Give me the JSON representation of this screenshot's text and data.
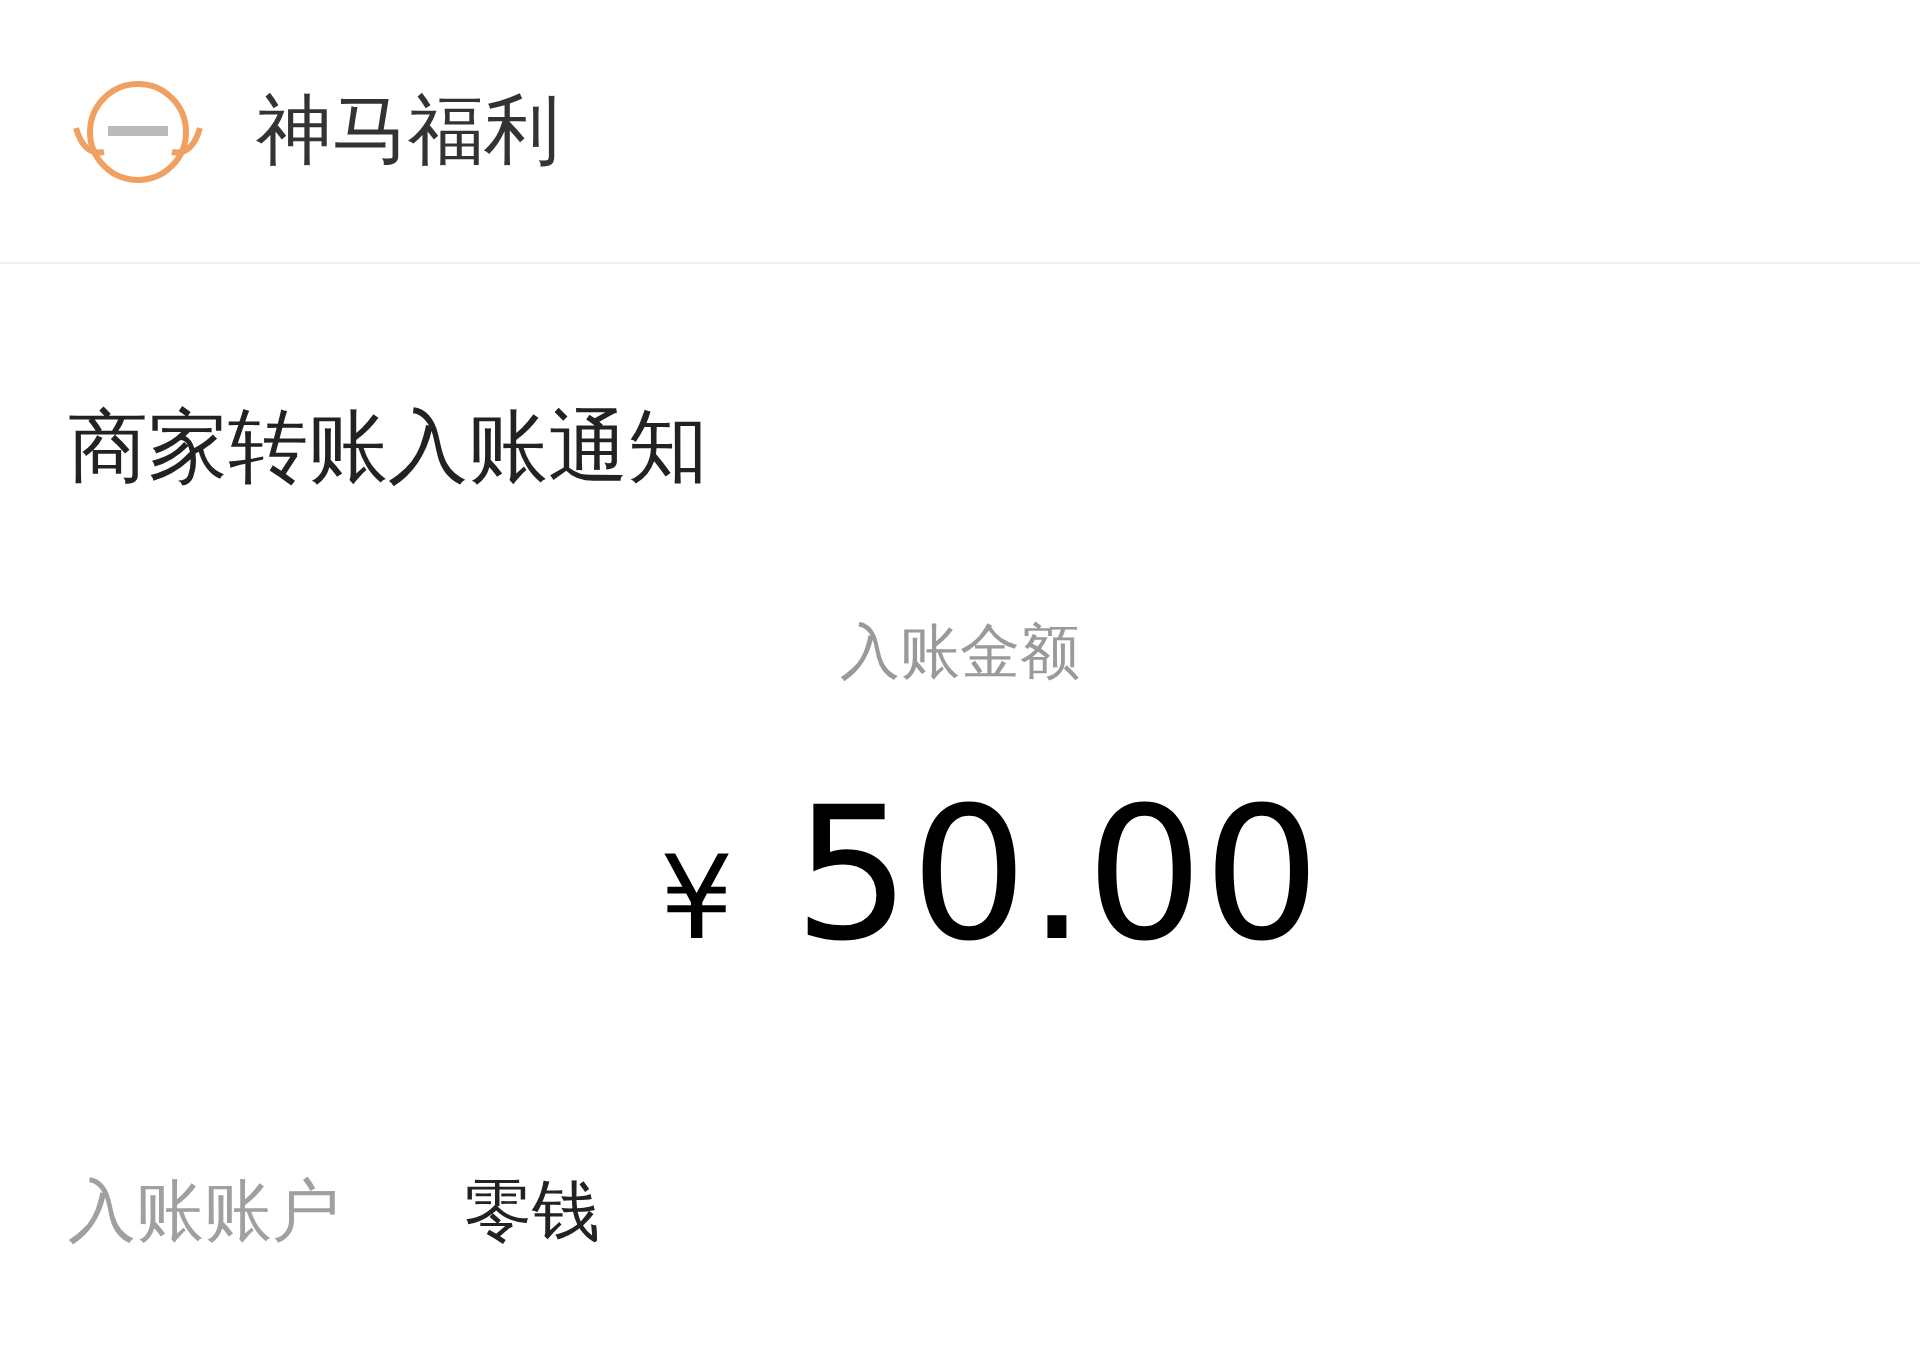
{
  "header": {
    "title": "神马福利"
  },
  "card": {
    "title": "商家转账入账通知",
    "amount_label": "入账金额",
    "currency": "¥",
    "amount": "50.00",
    "details": [
      {
        "label": "入账账户",
        "value": "零钱"
      }
    ]
  }
}
